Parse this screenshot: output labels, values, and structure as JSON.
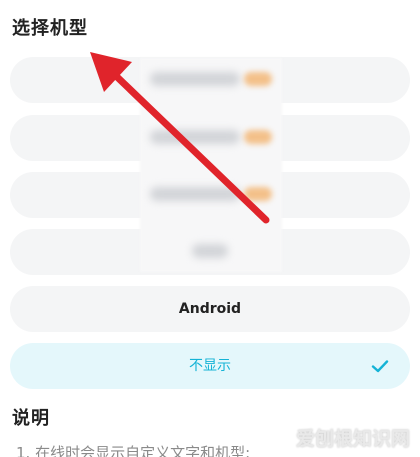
{
  "header": {
    "title": "选择机型"
  },
  "options": [
    {
      "label": "",
      "selected": false
    },
    {
      "label": "",
      "selected": false
    },
    {
      "label": "",
      "selected": false
    },
    {
      "label": "",
      "selected": false
    },
    {
      "label": "Android",
      "selected": false
    },
    {
      "label": "不显示",
      "selected": true
    }
  ],
  "description": {
    "title": "说明",
    "text": "1. 在线时会显示自定义文字和机型:"
  },
  "watermark": {
    "text": "爱刨根知识网"
  },
  "colors": {
    "accent": "#14b3d6",
    "arrow": "#e0242b",
    "selected_bg": "#e4f7fb",
    "option_bg": "#f4f5f6"
  },
  "icons": {
    "check": "check-icon",
    "arrow": "arrow-annotation-icon"
  }
}
